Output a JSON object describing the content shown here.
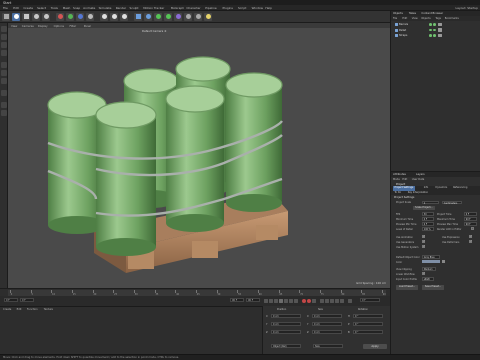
{
  "app": {
    "title": "Start",
    "layout_label": "Layout: Startup",
    "menu": [
      "File",
      "Edit",
      "Create",
      "Select",
      "Tools",
      "Mesh",
      "Snap",
      "Animate",
      "Simulate",
      "Render",
      "Sculpt",
      "Motion Tracker",
      "MoGraph",
      "Character",
      "Pipeline",
      "Plugins",
      "Script",
      "Window",
      "Help"
    ]
  },
  "viewport": {
    "menu": [
      "View",
      "Cameras",
      "Display",
      "Options",
      "Filter",
      "Panel"
    ],
    "camera_label": "Default Camera ✣",
    "grid_spacing": "Grid Spacing : 100 cm"
  },
  "timeline": {
    "ticks": [
      "0",
      "5",
      "10",
      "15",
      "20",
      "25",
      "30",
      "35",
      "40",
      "45",
      "50",
      "55",
      "60",
      "65",
      "70",
      "75",
      "80",
      "85",
      "90"
    ],
    "current_frame": "0 F",
    "start_frame": "0 F",
    "end_frame": "90 F",
    "max_frame": "90 F",
    "end_marker": "0 F"
  },
  "materials": {
    "menu": [
      "Create",
      "Edit",
      "Function",
      "Texture"
    ]
  },
  "coordinates": {
    "headers": [
      "Position",
      "Size",
      "Rotation"
    ],
    "rows": [
      {
        "axis": "X",
        "pos": "0 cm",
        "size": "0 cm",
        "rot_label": "H",
        "rot": "0 °"
      },
      {
        "axis": "Y",
        "pos": "0 cm",
        "size": "0 cm",
        "rot_label": "P",
        "rot": "0 °"
      },
      {
        "axis": "Z",
        "pos": "0 cm",
        "size": "0 cm",
        "rot_label": "B",
        "rot": "0 °"
      }
    ],
    "mode": "Object (Rel)",
    "size_mode": "Size",
    "apply": "Apply"
  },
  "status": {
    "text": "Move: Click and drag to move elements. Hold down SHIFT to quantize movement / add to the selection in point mode, CTRL to remove."
  },
  "objects": {
    "tabs": [
      "Objects",
      "Takes",
      "Content Browser"
    ],
    "menu": [
      "File",
      "Edit",
      "View",
      "Objects",
      "Tags",
      "Bookmarks"
    ],
    "items": [
      "Barrels",
      "Pallet",
      "Straps"
    ]
  },
  "attributes": {
    "tabs": [
      "Attributes",
      "Layers"
    ],
    "menu": [
      "Mode",
      "Edit",
      "User Data"
    ],
    "title": "Project",
    "subtabs": [
      "Project Settings",
      "Info",
      "Dynamics",
      "Referencing"
    ],
    "subtabs2": [
      "To Do",
      "Key Interpolation"
    ],
    "section": "Project Settings",
    "project_scale_label": "Project Scale",
    "project_scale_value": "1",
    "project_scale_unit": "Centimeters",
    "scale_button": "Scale Project...",
    "rows": [
      {
        "l": "FPS",
        "v": "30",
        "l2": "Project Time",
        "v2": "0 F"
      },
      {
        "l": "Minimum Time",
        "v": "0 F",
        "l2": "Maximum Time",
        "v2": "90 F"
      },
      {
        "l": "Preview Min Time",
        "v": "0 F",
        "l2": "Preview Max Time",
        "v2": "90 F"
      },
      {
        "l": "Level of Detail",
        "v": "100 %",
        "l2": "Render LOD in Editor",
        "v2": ""
      }
    ],
    "checks": [
      {
        "l": "Use Animation",
        "c": "✓",
        "l2": "Use Expression",
        "c2": "✓"
      },
      {
        "l": "Use Generators",
        "c": "✓",
        "l2": "Use Deformers",
        "c2": "✓"
      },
      {
        "l": "Use Motion System",
        "c": "✓",
        "l2": "",
        "c2": ""
      }
    ],
    "default_color_label": "Default Object Color",
    "default_color_value": "Gray Blue",
    "color_label": "Color",
    "view_clipping_label": "View Clipping",
    "view_clipping_value": "Medium",
    "linear_workflow_label": "Linear Workflow",
    "linear_workflow_check": "✓",
    "input_color_label": "Input Color Profile",
    "input_color_value": "sRGB",
    "load_preset": "Load Preset...",
    "save_preset": "Save Preset..."
  }
}
